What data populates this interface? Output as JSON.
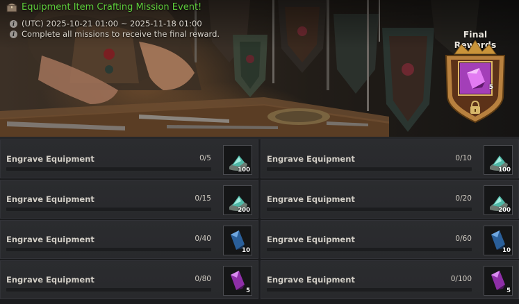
{
  "event": {
    "title": "Equipment Item Crafting Mission Event!",
    "period": "(UTC) 2025-10-21 01:00 ~ 2025-11-18 01:00",
    "description": "Complete all missions to receive the final reward.",
    "title_color": "#5fce3c",
    "title_icon": "treasure-chest-icon",
    "info_icon": "info-icon"
  },
  "final_rewards": {
    "label": "Final Rewards",
    "count": "5",
    "item_icon": "purple-crystal-icon",
    "lock_icon": "lock-icon"
  },
  "missions": [
    {
      "label": "Engrave Equipment",
      "progress": "0/5",
      "current": 0,
      "target": 5,
      "reward_icon": "teal-stone-icon",
      "reward_count": "100"
    },
    {
      "label": "Engrave Equipment",
      "progress": "0/10",
      "current": 0,
      "target": 10,
      "reward_icon": "teal-stone-icon",
      "reward_count": "100"
    },
    {
      "label": "Engrave Equipment",
      "progress": "0/15",
      "current": 0,
      "target": 15,
      "reward_icon": "teal-stone-icon",
      "reward_count": "200"
    },
    {
      "label": "Engrave Equipment",
      "progress": "0/20",
      "current": 0,
      "target": 20,
      "reward_icon": "teal-stone-icon",
      "reward_count": "200"
    },
    {
      "label": "Engrave Equipment",
      "progress": "0/40",
      "current": 0,
      "target": 40,
      "reward_icon": "blue-crystal-icon",
      "reward_count": "10"
    },
    {
      "label": "Engrave Equipment",
      "progress": "0/60",
      "current": 0,
      "target": 60,
      "reward_icon": "blue-crystal-icon",
      "reward_count": "10"
    },
    {
      "label": "Engrave Equipment",
      "progress": "0/80",
      "current": 0,
      "target": 80,
      "reward_icon": "purple-crystal-icon",
      "reward_count": "5"
    },
    {
      "label": "Engrave Equipment",
      "progress": "0/100",
      "current": 0,
      "target": 100,
      "reward_icon": "purple-crystal-icon",
      "reward_count": "5"
    }
  ],
  "colors": {
    "progress_fill": "#8a7a55",
    "crest_gold": "#c9943a",
    "purple_crystal": "#c54fd8"
  }
}
